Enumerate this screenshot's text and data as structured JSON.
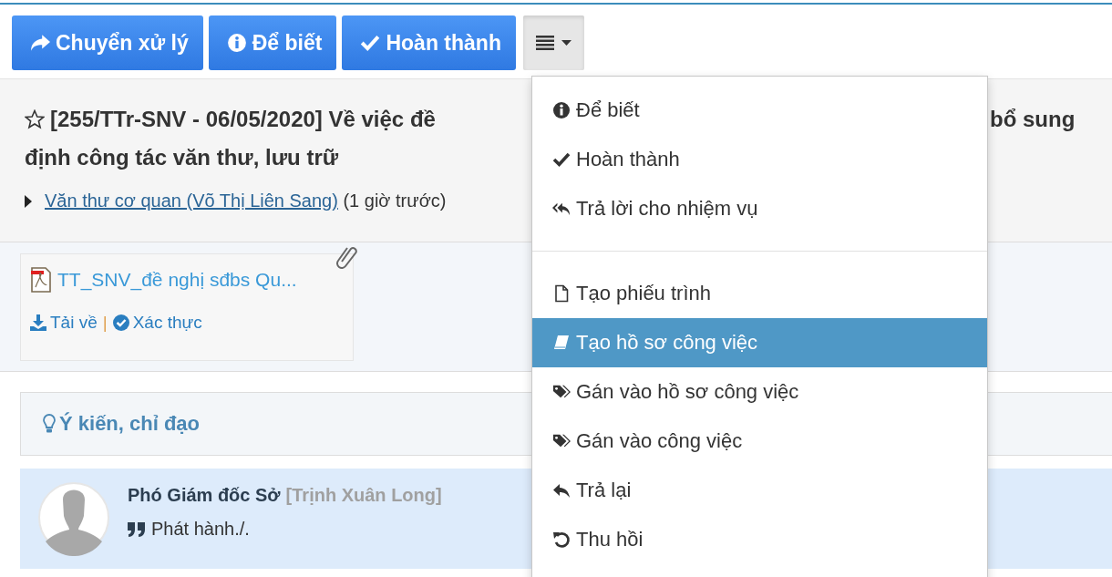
{
  "toolbar": {
    "buttons": [
      {
        "label": "Chuyển xử lý",
        "kind": "share"
      },
      {
        "label": "Để biết",
        "kind": "info"
      },
      {
        "label": "Hoàn thành",
        "kind": "check"
      }
    ],
    "menu_toggle": {
      "expanded": true
    }
  },
  "document": {
    "starred": false,
    "title_visible": "[255/TTr-SNV - 06/05/2020] Về việc đề",
    "title_continuation": "bổ sung",
    "title_line_2": "định công tác văn thư, lưu trữ",
    "sender_link": "Văn thư cơ quan (Võ Thị Liên Sang)",
    "sent_time": "(1 giờ trước)"
  },
  "attachment": {
    "file_name": "TT_SNV_đề nghị sđbs Qu...",
    "download": "Tải về",
    "separator": "|",
    "verify": "Xác thực"
  },
  "comments_panel": {
    "title": "Ý kiến, chỉ đạo"
  },
  "comments": [
    {
      "role": "Phó Giám đốc Sở",
      "name": "[Trịnh Xuân Long]",
      "text": "Phát hành./."
    }
  ],
  "dropdown_menu": {
    "items": [
      {
        "kind": "info",
        "label": "Để biết",
        "selected": false
      },
      {
        "kind": "check",
        "label": "Hoàn thành",
        "selected": false
      },
      {
        "kind": "reply-all",
        "label": "Trả lời cho nhiệm vụ",
        "selected": false
      },
      {
        "kind": "divider"
      },
      {
        "kind": "file",
        "label": "Tạo phiếu trình",
        "selected": false
      },
      {
        "kind": "book",
        "label": "Tạo hồ sơ công việc",
        "selected": true
      },
      {
        "kind": "tags",
        "label": "Gán vào hồ sơ công việc",
        "selected": false
      },
      {
        "kind": "tags",
        "label": "Gán vào công việc",
        "selected": false
      },
      {
        "kind": "reply",
        "label": "Trả lại",
        "selected": false
      },
      {
        "kind": "undo",
        "label": "Thu hồi",
        "selected": false
      }
    ]
  }
}
